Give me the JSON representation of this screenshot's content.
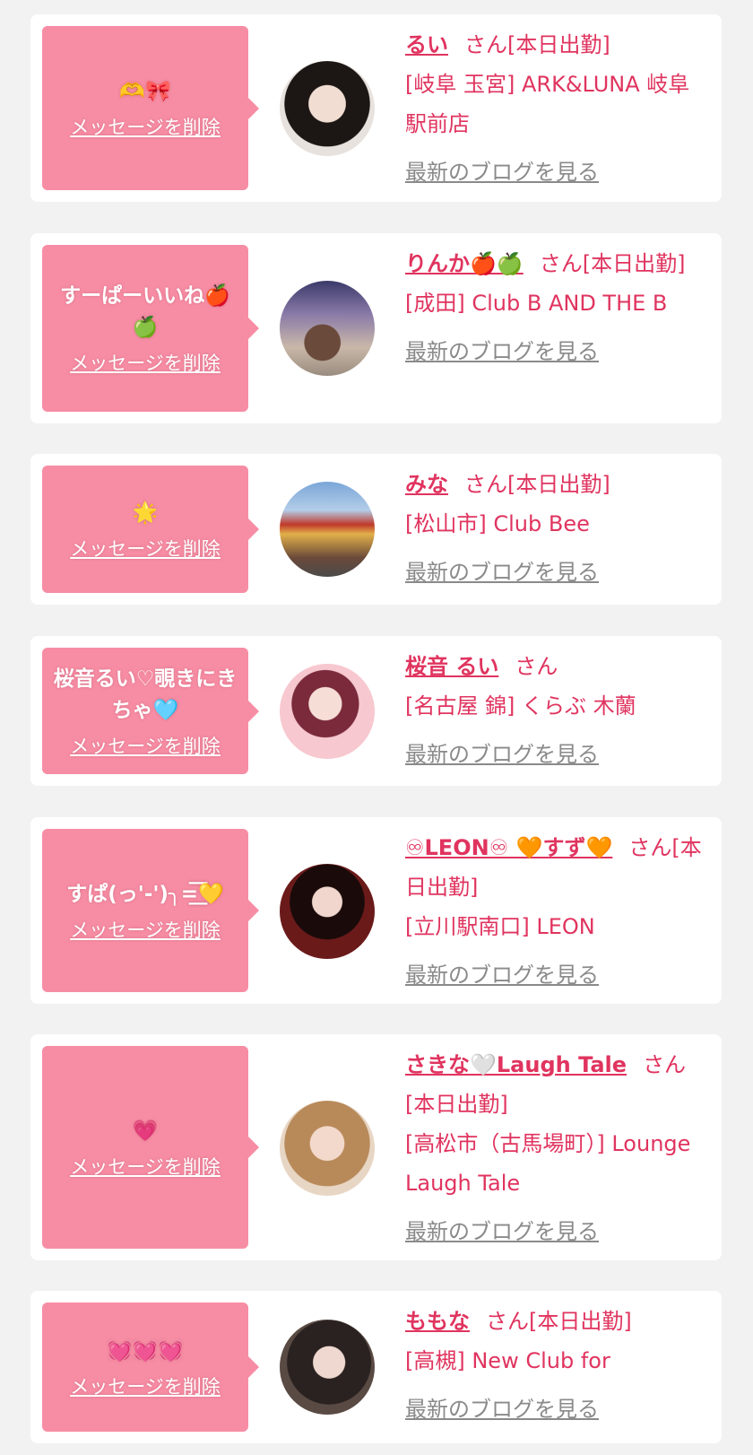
{
  "delete_label": "メッセージを削除",
  "blog_label": "最新のブログを見る",
  "colors": {
    "accent": "#e0345f",
    "bubble": "#f78da4",
    "background": "#f2f2f2"
  },
  "items": [
    {
      "message": "🫶🎀",
      "name": "るい",
      "status": "さん[本日出勤]",
      "shop": "[岐阜 玉宮] ARK&LUNA 岐阜駅前店"
    },
    {
      "message": "すーぱーいいね🍎🍏",
      "name": "りんか🍎🍏",
      "status": "さん[本日出勤]",
      "shop": "[成田] Club B AND THE B"
    },
    {
      "message": "🌟",
      "name": "みな",
      "status": "さん[本日出勤]",
      "shop": "[松山市] Club Bee"
    },
    {
      "message": "桜音るい♡覗きにきちゃ🩵",
      "name": "桜音 るい",
      "status": "さん",
      "shop": "[名古屋 錦] くらぶ 木蘭"
    },
    {
      "message": "すぱ(っ'-')╮=͟͟͞͞💛",
      "name": "♾LEON♾ 🧡すず🧡",
      "status": "さん[本日出勤]",
      "shop": "[立川駅南口] LEON"
    },
    {
      "message": "💗",
      "name": "さきな🤍Laugh Tale",
      "status": "さん[本日出勤]",
      "shop": "[高松市（古馬場町）] Lounge Laugh Tale"
    },
    {
      "message": "💓💓💓",
      "name": "ももな",
      "status": "さん[本日出勤]",
      "shop": "[高槻] New Club for"
    }
  ]
}
